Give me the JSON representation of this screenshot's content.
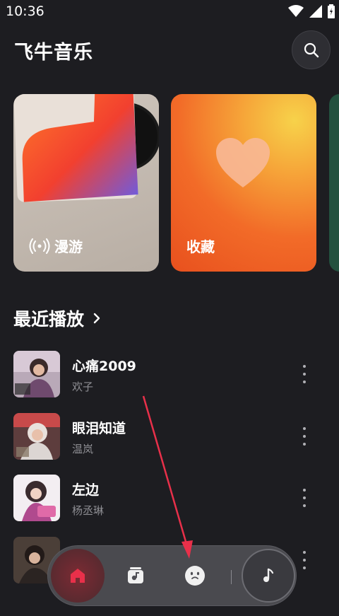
{
  "status_bar": {
    "time": "10:36"
  },
  "header": {
    "title": "飞牛音乐"
  },
  "cards": [
    {
      "label": "漫游"
    },
    {
      "label": "收藏"
    }
  ],
  "recent": {
    "title": "最近播放"
  },
  "songs": [
    {
      "title": "心痛2009",
      "artist": "欢子"
    },
    {
      "title": "眼泪知道",
      "artist": "温岚"
    },
    {
      "title": "左边",
      "artist": "杨丞琳"
    }
  ],
  "colors": {
    "accent": "#e8304a",
    "background": "#1d1d21",
    "fav_card": "#f26b28"
  }
}
